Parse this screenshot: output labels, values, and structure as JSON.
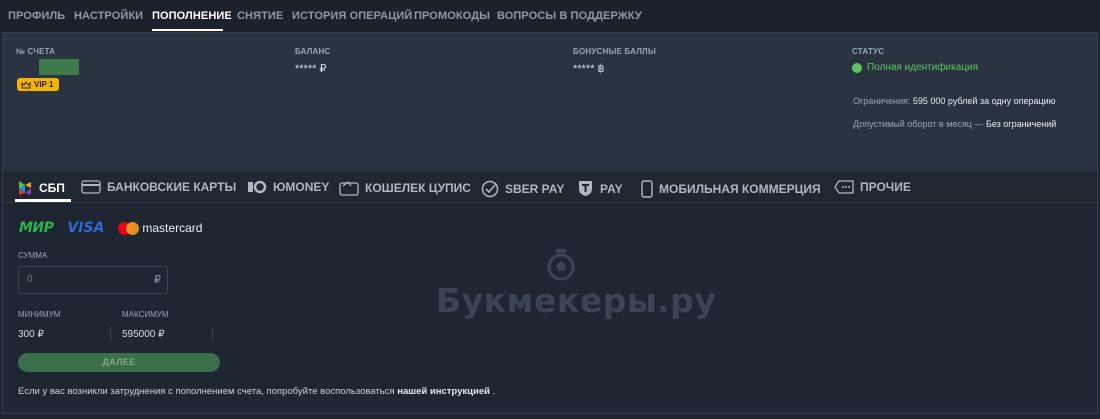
{
  "topnav": {
    "tabs": [
      {
        "label": "ПРОФИЛЬ"
      },
      {
        "label": "НАСТРОЙКИ"
      },
      {
        "label": "ПОПОЛНЕНИЕ",
        "active": true
      },
      {
        "label": "СНЯТИЕ"
      },
      {
        "label": "ИСТОРИЯ ОПЕРАЦИЙ"
      },
      {
        "label": "ПРОМОКОДЫ"
      },
      {
        "label": "ВОПРОСЫ В ПОДДЕРЖКУ"
      }
    ]
  },
  "account": {
    "number_label": "№ СЧЕТА",
    "vip_badge": "VIP 1",
    "balance_label": "БАЛАНС",
    "balance_value": "***** ₽",
    "bonus_label": "БОНУСНЫЕ БАЛЛЫ",
    "bonus_value": "***** ฿",
    "status_label": "СТАТУС",
    "status_value": "Полная идентификация",
    "limit_prefix": "Ограничения:",
    "limit_value": "595 000 рублей за одну операцию",
    "turnover_prefix": "Допустимый оборот в месяц —",
    "turnover_value": "Без ограничений"
  },
  "payment_tabs": [
    {
      "label": "СБП",
      "icon": "sbp-icon",
      "active": true
    },
    {
      "label": "БАНКОВСКИЕ КАРТЫ",
      "icon": "bank-card-icon"
    },
    {
      "label": "ЮMONEY",
      "icon": "yoomoney-icon"
    },
    {
      "label": "КОШЕЛЕК ЦУПИС",
      "icon": "wallet-icon"
    },
    {
      "label": "SBER PAY",
      "icon": "sberpay-icon"
    },
    {
      "label": "PAY",
      "icon": "t-pay-icon"
    },
    {
      "label": "МОБИЛЬНАЯ КОММЕРЦИЯ",
      "icon": "mobile-phone-icon"
    },
    {
      "label": "ПРОЧИЕ",
      "icon": "other-icon"
    }
  ],
  "form": {
    "logos": {
      "mir": "МИР",
      "visa": "VISA",
      "mastercard": "mastercard"
    },
    "amount_label": "СУММА",
    "amount_placeholder": "0",
    "amount_currency": "₽",
    "min_label": "МИНИМУМ",
    "min_value": "300 ₽",
    "max_label": "МАКСИМУМ",
    "max_value": "595000 ₽",
    "submit_label": "ДАЛЕЕ",
    "help_text": "Если у вас возникли затруднения с пополнением счета, попробуйте воспользоваться",
    "help_link": "нашей инструкцией",
    "help_tail": "."
  },
  "watermark": {
    "text": "Букмекеры.ру"
  },
  "colors": {
    "accent_green": "#5cc45f",
    "vip_yellow": "#f6b400",
    "button_green": "#3b6e4a",
    "background": "#1e2631",
    "panel": "#2a3441"
  }
}
